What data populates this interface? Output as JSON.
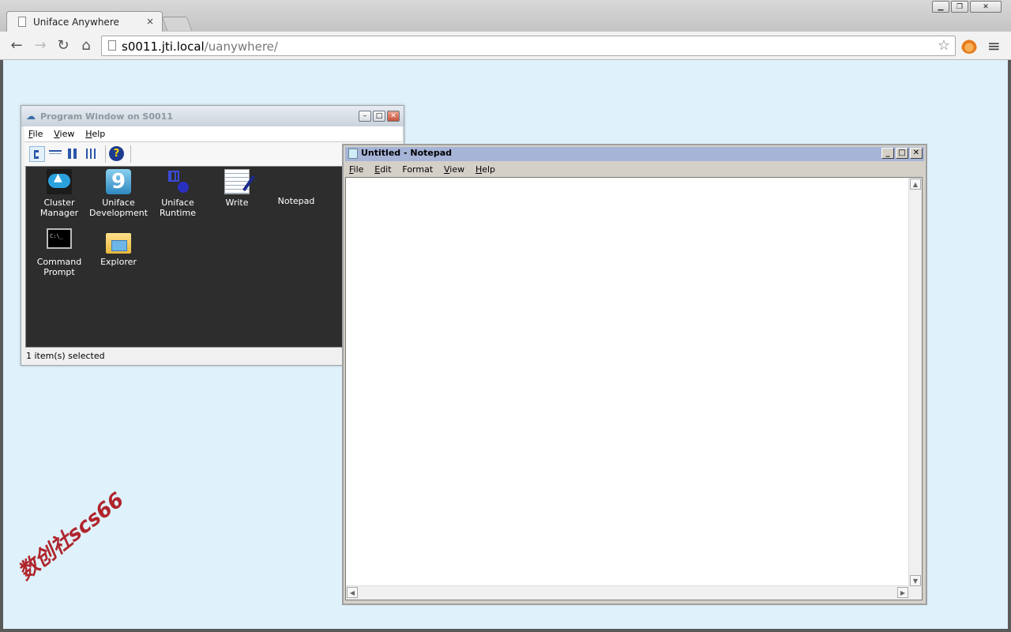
{
  "browser": {
    "tab_title": "Uniface Anywhere",
    "tab_close": "×",
    "url_host": "s0011.jti.local",
    "url_path": "/uanywhere/"
  },
  "program_window": {
    "title": "Program Window on S0011",
    "menu": [
      {
        "label": "File",
        "underline": "F",
        "rest": "ile"
      },
      {
        "label": "View",
        "underline": "V",
        "rest": "iew"
      },
      {
        "label": "Help",
        "underline": "H",
        "rest": "elp"
      }
    ],
    "icons": [
      {
        "name": "cluster-manager",
        "line1": "Cluster",
        "line2": "Manager",
        "icon": "cluster-icon"
      },
      {
        "name": "uniface-development",
        "line1": "Uniface",
        "line2": "Development",
        "icon": "uniface-dev-icon"
      },
      {
        "name": "uniface-runtime",
        "line1": "Uniface",
        "line2": "Runtime",
        "icon": "uniface-runtime-icon"
      },
      {
        "name": "write",
        "line1": "Write",
        "line2": "",
        "icon": "write-icon"
      },
      {
        "name": "notepad",
        "line1": "Notepad",
        "line2": "",
        "icon": "notepad-icon"
      },
      {
        "name": "command-prompt",
        "line1": "Command",
        "line2": "Prompt",
        "icon": "cmd-icon"
      },
      {
        "name": "explorer",
        "line1": "Explorer",
        "line2": "",
        "icon": "explorer-icon"
      }
    ],
    "status": "1 item(s) selected"
  },
  "notepad": {
    "title": "Untitled - Notepad",
    "menu": [
      {
        "underline": "F",
        "rest": "ile"
      },
      {
        "underline": "E",
        "rest": "dit"
      },
      {
        "underline": "",
        "rest": "Format"
      },
      {
        "underline": "V",
        "rest": "iew"
      },
      {
        "underline": "H",
        "rest": "elp"
      }
    ]
  },
  "watermark": "数创社scs66",
  "colors": {
    "page_bg": "#dff1fa",
    "notepad_title": "#a6b4d8",
    "watermark": "#b0242c"
  }
}
